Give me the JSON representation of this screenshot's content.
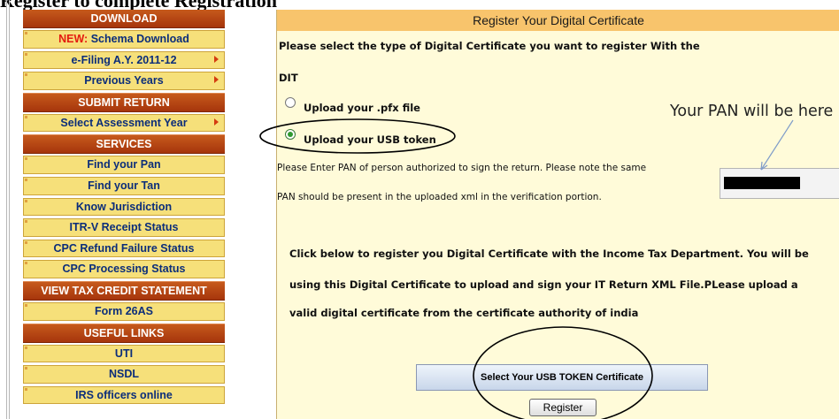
{
  "page": {
    "heading": "Register to complete Registration"
  },
  "sidebar": {
    "rows": [
      {
        "type": "header",
        "label": "DOWNLOAD"
      },
      {
        "type": "item",
        "prefix": "NEW:",
        "label": "Schema Download",
        "arrow": false
      },
      {
        "type": "item",
        "prefix": "",
        "label": "e-Filing A.Y. 2011-12",
        "arrow": true
      },
      {
        "type": "item",
        "prefix": "",
        "label": "Previous Years",
        "arrow": true
      },
      {
        "type": "header",
        "label": "SUBMIT RETURN"
      },
      {
        "type": "item",
        "prefix": "",
        "label": "Select Assessment Year",
        "arrow": true
      },
      {
        "type": "header",
        "label": "SERVICES"
      },
      {
        "type": "item",
        "prefix": "",
        "label": "Find your Pan",
        "arrow": false
      },
      {
        "type": "item",
        "prefix": "",
        "label": "Find your Tan",
        "arrow": false
      },
      {
        "type": "item",
        "prefix": "",
        "label": "Know Jurisdiction",
        "arrow": false
      },
      {
        "type": "item",
        "prefix": "",
        "label": "ITR-V Receipt Status",
        "arrow": false
      },
      {
        "type": "item",
        "prefix": "",
        "label": "CPC Refund Failure Status",
        "arrow": false
      },
      {
        "type": "item",
        "prefix": "",
        "label": "CPC Processing Status",
        "arrow": false
      },
      {
        "type": "header",
        "label": "VIEW TAX CREDIT STATEMENT"
      },
      {
        "type": "item",
        "prefix": "",
        "label": "Form 26AS",
        "arrow": false
      },
      {
        "type": "header",
        "label": "USEFUL LINKS"
      },
      {
        "type": "item",
        "prefix": "",
        "label": "UTI",
        "arrow": false
      },
      {
        "type": "item",
        "prefix": "",
        "label": "NSDL",
        "arrow": false
      },
      {
        "type": "item",
        "prefix": "",
        "label": "IRS officers online",
        "arrow": false
      }
    ]
  },
  "main": {
    "title": "Register Your Digital Certificate",
    "select_prompt_line1": "Please select the type of Digital Certificate you want to register With the",
    "select_prompt_line2": "DIT",
    "options": [
      {
        "label": "Upload your .pfx file",
        "checked": false
      },
      {
        "label": "Upload your USB token",
        "checked": true
      }
    ],
    "pan_note_line1": "Please Enter PAN of person authorized to sign the return. Please note the same",
    "pan_note_line2": "PAN should be present in the uploaded xml in the verification portion.",
    "info_line1": "Click below to register you Digital Certificate with the Income Tax Department. You will be",
    "info_line2": "using this Digital Certificate to upload and sign your IT Return XML File.PLease upload a",
    "info_line3": "valid digital certificate from the certificate authority of india",
    "select_cert_button": "Select Your USB TOKEN Certificate",
    "register_button": "Register"
  },
  "annotation": {
    "text": "Your PAN will be here"
  }
}
